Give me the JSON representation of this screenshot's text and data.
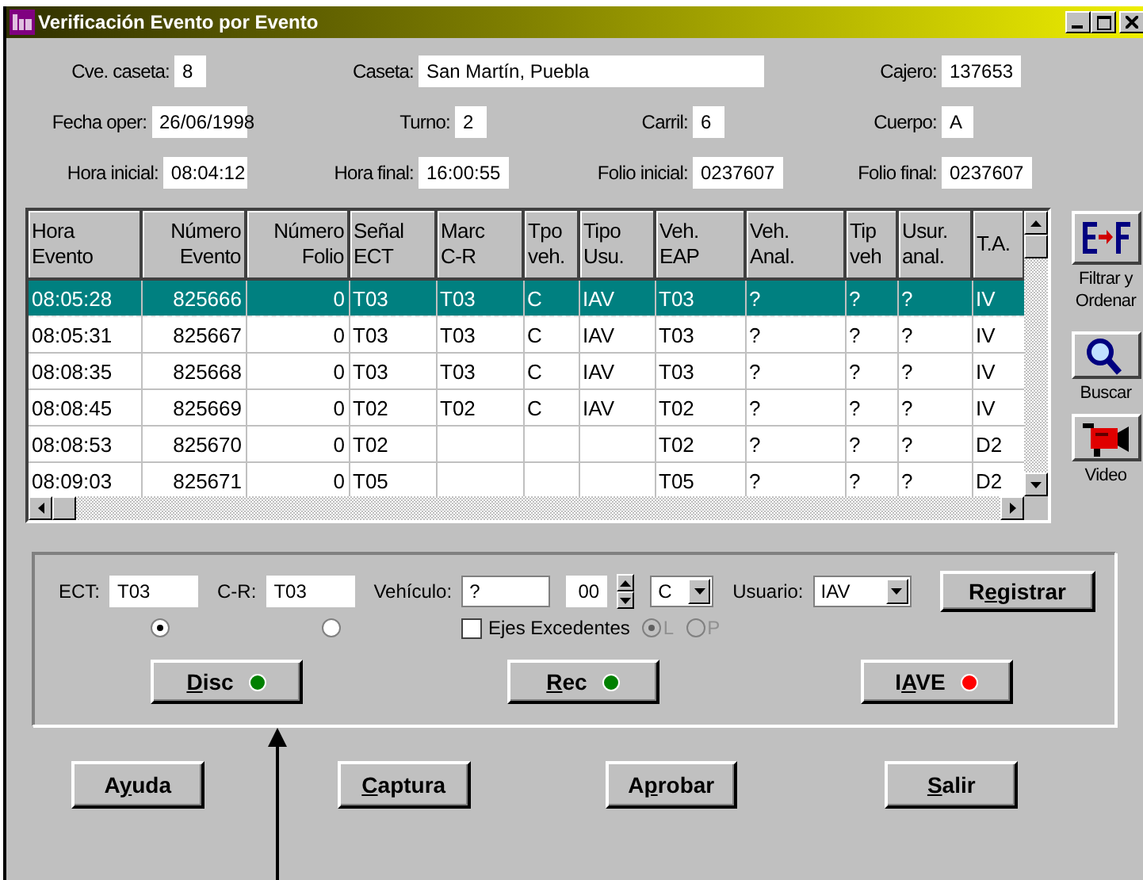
{
  "window": {
    "title": "Verificación Evento por Evento"
  },
  "header_rows": [
    [
      {
        "label": "Cve. caseta:",
        "value": "8"
      },
      {
        "label": "Caseta:",
        "value": "San Martín, Puebla"
      },
      {
        "label": "Cajero:",
        "value": "137653"
      }
    ],
    [
      {
        "label": "Fecha oper:",
        "value": "26/06/1998"
      },
      {
        "label": "Turno:",
        "value": "2"
      },
      {
        "label": "Carril:",
        "value": "6"
      },
      {
        "label": "Cuerpo:",
        "value": "A"
      }
    ],
    [
      {
        "label": "Hora inicial:",
        "value": "08:04:12"
      },
      {
        "label": "Hora final:",
        "value": "16:00:55"
      },
      {
        "label": "Folio inicial:",
        "value": "0237607"
      },
      {
        "label": "Folio final:",
        "value": "0237607"
      }
    ]
  ],
  "table": {
    "columns": [
      "Hora\nEvento",
      "Número\nEvento",
      "Número\nFolio",
      "Señal\nECT",
      "Marc\nC-R",
      "Tpo\nveh.",
      "Tipo\nUsu.",
      "Veh.\nEAP",
      "Veh.\nAnal.",
      "Tip\nveh",
      "Usur.\nanal.",
      "T.A."
    ],
    "rows": [
      {
        "selected": true,
        "cells": [
          "08:05:28",
          "825666",
          "0",
          "T03",
          "T03",
          "C",
          "IAV",
          "T03",
          "?",
          "?",
          "?",
          "IV"
        ]
      },
      {
        "selected": false,
        "cells": [
          "08:05:31",
          "825667",
          "0",
          "T03",
          "T03",
          "C",
          "IAV",
          "T03",
          "?",
          "?",
          "?",
          "IV"
        ]
      },
      {
        "selected": false,
        "cells": [
          "08:08:35",
          "825668",
          "0",
          "T03",
          "T03",
          "C",
          "IAV",
          "T03",
          "?",
          "?",
          "?",
          "IV"
        ]
      },
      {
        "selected": false,
        "cells": [
          "08:08:45",
          "825669",
          "0",
          "T02",
          "T02",
          "C",
          "IAV",
          "T02",
          "?",
          "?",
          "?",
          "IV"
        ]
      },
      {
        "selected": false,
        "cells": [
          "08:08:53",
          "825670",
          "0",
          "T02",
          "",
          "",
          "",
          "T02",
          "?",
          "?",
          "?",
          "D2"
        ]
      },
      {
        "selected": false,
        "cells": [
          "08:09:03",
          "825671",
          "0",
          "T05",
          "",
          "",
          "",
          "T05",
          "?",
          "?",
          "?",
          "D2"
        ]
      }
    ]
  },
  "side_tools": [
    {
      "kind": "filter",
      "label": "Filtrar y\nOrdenar"
    },
    {
      "kind": "search",
      "label": "Buscar"
    },
    {
      "kind": "video",
      "label": "Video"
    }
  ],
  "form": {
    "ect": {
      "label": "ECT:",
      "value": "T03",
      "selected": true
    },
    "cr": {
      "label": "C-R:",
      "value": "T03",
      "selected": false
    },
    "vehicle": {
      "label": "Vehículo:",
      "value": "?"
    },
    "axles": {
      "value": "00"
    },
    "class_combo": {
      "value": "C"
    },
    "user": {
      "label": "Usuario:",
      "value": "IAV"
    },
    "register": {
      "pre": "R",
      "key": "e",
      "post": "gistrar"
    },
    "extra_axles": {
      "label": "Ejes Excedentes",
      "checked": false
    },
    "axle_options": [
      {
        "label": "L",
        "selected": true,
        "disabled": true
      },
      {
        "label": "P",
        "selected": false,
        "disabled": true
      }
    ],
    "status_buttons": [
      {
        "key": "D",
        "post": "isc",
        "color": "#008000"
      },
      {
        "key": "R",
        "post": "ec",
        "color": "#008000"
      },
      {
        "pre": "I",
        "key": "A",
        "post": "VE",
        "color": "#ff0000"
      }
    ]
  },
  "buttons": [
    {
      "pre": "A",
      "key": "y",
      "post": "uda"
    },
    {
      "key": "C",
      "post": "aptura"
    },
    {
      "pre": "A",
      "key": "p",
      "post": "robar"
    },
    {
      "key": "S",
      "post": "alir"
    }
  ]
}
